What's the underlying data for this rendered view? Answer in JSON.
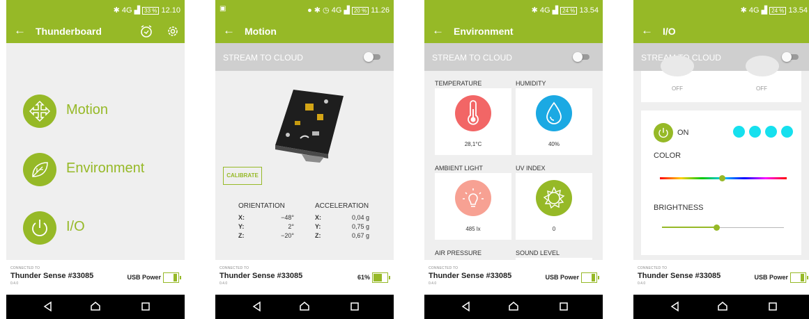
{
  "colors": {
    "accent": "#96b927",
    "temperature": "#f26666",
    "humidity": "#1ba9e3",
    "light": "#f7a193",
    "uv": "#96b927",
    "led": "#16e0ee"
  },
  "screens": [
    {
      "status": {
        "time": "12.10",
        "battery": "33 %",
        "network": "4G"
      },
      "app": {
        "title": "Thunderboard"
      },
      "menu": [
        {
          "label": "Motion",
          "icon": "move-arrows-icon"
        },
        {
          "label": "Environment",
          "icon": "leaf-icon"
        },
        {
          "label": "I/O",
          "icon": "power-icon"
        }
      ],
      "footer": {
        "caption": "CONNECTED TO",
        "device": "Thunder Sense #33085",
        "version": "0.4.0",
        "power": "USB Power"
      }
    },
    {
      "status": {
        "time": "11.26",
        "battery": "20 %",
        "network": "4G"
      },
      "app": {
        "title": "Motion"
      },
      "stream": "STREAM TO CLOUD",
      "calibrate": "CALIBRATE",
      "orientation": {
        "title": "ORIENTATION",
        "rows": [
          {
            "axis": "X:",
            "value": "−48°"
          },
          {
            "axis": "Y:",
            "value": "2°"
          },
          {
            "axis": "Z:",
            "value": "−20°"
          }
        ]
      },
      "acceleration": {
        "title": "ACCELERATION",
        "rows": [
          {
            "axis": "X:",
            "value": "0,04 g"
          },
          {
            "axis": "Y:",
            "value": "0,75 g"
          },
          {
            "axis": "Z:",
            "value": "0,67 g"
          }
        ]
      },
      "footer": {
        "caption": "CONNECTED TO",
        "device": "Thunder Sense #33085",
        "version": "0.4.0",
        "power": "61%",
        "battery_level": 0.61
      }
    },
    {
      "status": {
        "time": "13.54",
        "battery": "24 %",
        "network": "4G"
      },
      "app": {
        "title": "Environment"
      },
      "stream": "STREAM TO CLOUD",
      "sensors": [
        {
          "label": "TEMPERATURE",
          "value": "28,1°C",
          "icon": "thermometer-icon"
        },
        {
          "label": "HUMIDITY",
          "value": "40%",
          "icon": "droplet-icon"
        },
        {
          "label": "AMBIENT LIGHT",
          "value": "485 lx",
          "icon": "lightbulb-icon"
        },
        {
          "label": "UV INDEX",
          "value": "0",
          "icon": "sun-icon"
        },
        {
          "label": "AIR PRESSURE"
        },
        {
          "label": "SOUND LEVEL"
        }
      ],
      "footer": {
        "caption": "CONNECTED TO",
        "device": "Thunder Sense #33085",
        "version": "0.4.0",
        "power": "USB Power"
      }
    },
    {
      "status": {
        "time": "13.54",
        "battery": "24 %",
        "network": "4G"
      },
      "app": {
        "title": "I/O"
      },
      "stream": "STREAM TO CLOUD",
      "switches": [
        {
          "state": "OFF"
        },
        {
          "state": "OFF"
        }
      ],
      "led": {
        "state": "ON",
        "color_label": "COLOR",
        "brightness_label": "BRIGHTNESS",
        "color_position": 0.49,
        "brightness_level": 0.45
      },
      "footer": {
        "caption": "CONNECTED TO",
        "device": "Thunder Sense #33085",
        "version": "0.4.0",
        "power": "USB Power"
      }
    }
  ]
}
